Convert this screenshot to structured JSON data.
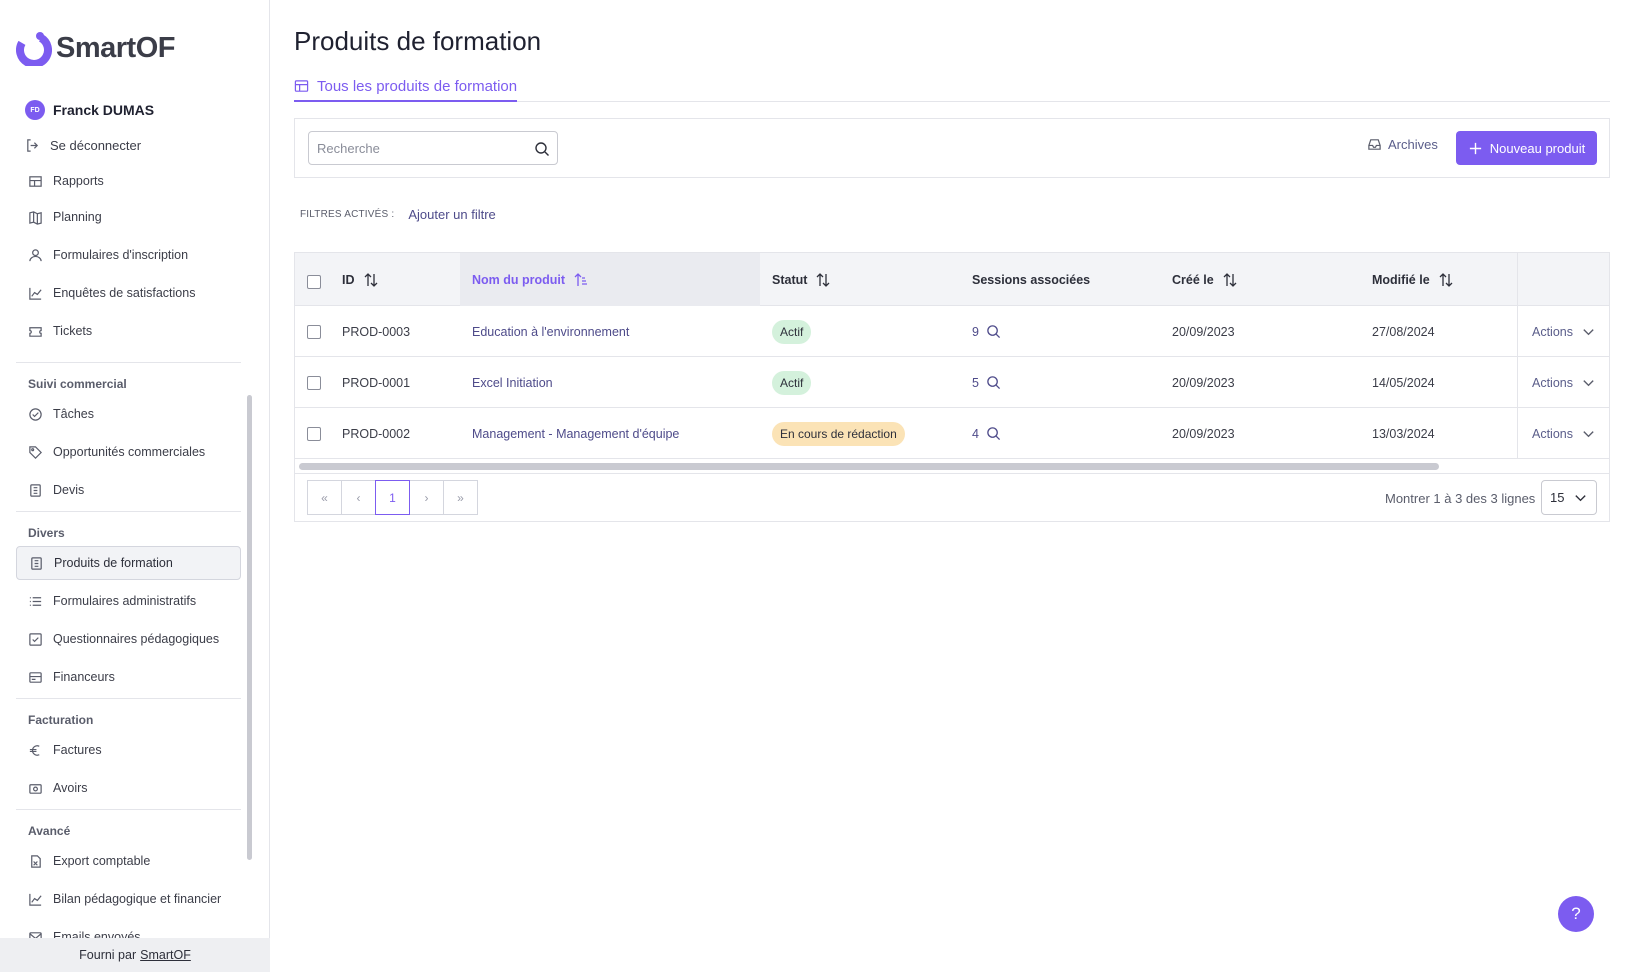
{
  "brand": {
    "name": "SmartOF"
  },
  "user": {
    "initials": "FD",
    "name": "Franck DUMAS",
    "logout_label": "Se déconnecter"
  },
  "sidebar": {
    "items_top": [
      {
        "label": "Rapports",
        "icon": "report-icon"
      },
      {
        "label": "Planning",
        "icon": "map-icon"
      },
      {
        "label": "Formulaires d'inscription",
        "icon": "user-icon"
      },
      {
        "label": "Enquêtes de satisfactions",
        "icon": "chart-line-icon"
      },
      {
        "label": "Tickets",
        "icon": "ticket-icon"
      }
    ],
    "sections": [
      {
        "title": "Suivi commercial",
        "items": [
          {
            "label": "Tâches",
            "icon": "check-circle-icon"
          },
          {
            "label": "Opportunités commerciales",
            "icon": "tag-icon"
          },
          {
            "label": "Devis",
            "icon": "document-icon"
          }
        ]
      },
      {
        "title": "Divers",
        "items": [
          {
            "label": "Produits de formation",
            "icon": "book-icon",
            "active": true
          },
          {
            "label": "Formulaires administratifs",
            "icon": "list-icon"
          },
          {
            "label": "Questionnaires pédagogiques",
            "icon": "checkbox-icon"
          },
          {
            "label": "Financeurs",
            "icon": "card-icon"
          }
        ]
      },
      {
        "title": "Facturation",
        "items": [
          {
            "label": "Factures",
            "icon": "euro-icon"
          },
          {
            "label": "Avoirs",
            "icon": "money-icon"
          }
        ]
      },
      {
        "title": "Avancé",
        "items": [
          {
            "label": "Export comptable",
            "icon": "file-excel-icon"
          },
          {
            "label": "Bilan pédagogique et financier",
            "icon": "chart-line-icon"
          },
          {
            "label": "Emails envoyés",
            "icon": "mail-icon"
          }
        ]
      }
    ],
    "footer_prefix": "Fourni par",
    "footer_link": "SmartOF"
  },
  "main": {
    "title": "Produits de formation",
    "tab_label": "Tous les produits de formation",
    "search_placeholder": "Recherche",
    "archives_label": "Archives",
    "new_button_label": "Nouveau produit",
    "filters_label": "FILTRES ACTIVÉS :",
    "add_filter_label": "Ajouter un filtre"
  },
  "table": {
    "columns": [
      "ID",
      "Nom du produit",
      "Statut",
      "Sessions associées",
      "Créé le",
      "Modifié le"
    ],
    "rows": [
      {
        "id": "PROD-0003",
        "name": "Education à l'environnement",
        "status": "Actif",
        "status_color": "green",
        "sessions": "9",
        "created": "20/09/2023",
        "modified": "27/08/2024",
        "actions": "Actions"
      },
      {
        "id": "PROD-0001",
        "name": "Excel Initiation",
        "status": "Actif",
        "status_color": "green",
        "sessions": "5",
        "created": "20/09/2023",
        "modified": "14/05/2024",
        "actions": "Actions"
      },
      {
        "id": "PROD-0002",
        "name": "Management - Management d'équipe",
        "status": "En cours de rédaction",
        "status_color": "yellow",
        "sessions": "4",
        "created": "20/09/2023",
        "modified": "13/03/2024",
        "actions": "Actions"
      }
    ]
  },
  "pagination": {
    "first": "«",
    "prev": "‹",
    "current": "1",
    "next": "›",
    "last": "»",
    "summary": "Montrer 1 à 3 des 3 lignes",
    "page_size": "15"
  },
  "help_label": "?",
  "colors": {
    "accent": "#7c5cf0",
    "active_badge": "#d4f1dc",
    "draft_badge": "#fbe3b6"
  }
}
